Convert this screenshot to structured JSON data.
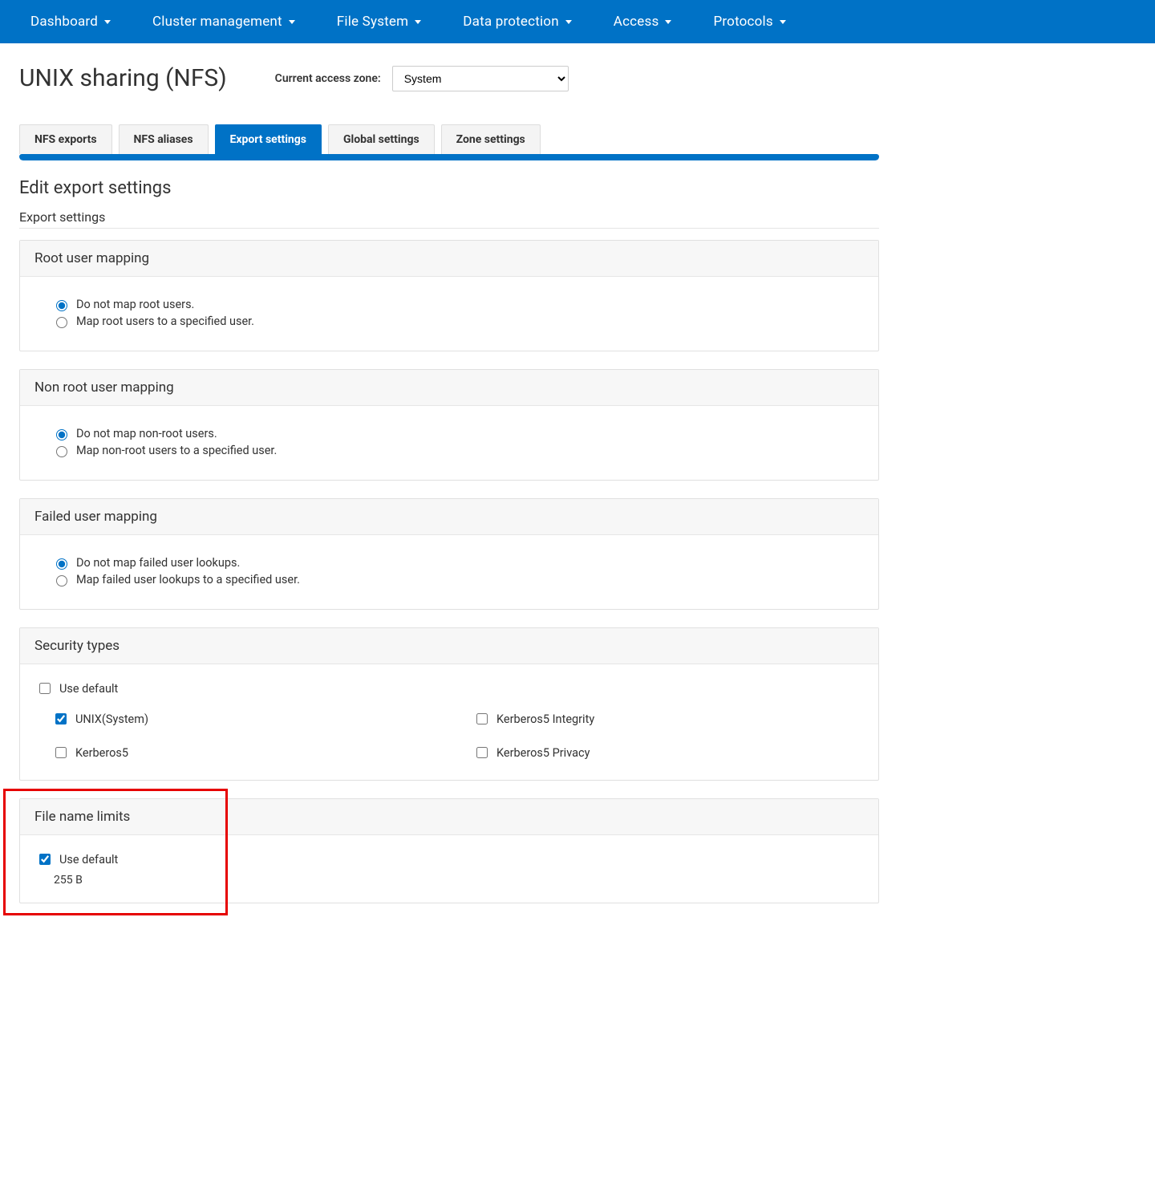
{
  "nav": {
    "items": [
      {
        "label": "Dashboard"
      },
      {
        "label": "Cluster management"
      },
      {
        "label": "File System"
      },
      {
        "label": "Data protection"
      },
      {
        "label": "Access"
      },
      {
        "label": "Protocols"
      }
    ]
  },
  "page": {
    "title": "UNIX sharing (NFS)",
    "zone_label": "Current access zone:",
    "zone_value": "System"
  },
  "tabs": [
    {
      "label": "NFS exports",
      "active": false
    },
    {
      "label": "NFS aliases",
      "active": false
    },
    {
      "label": "Export settings",
      "active": true
    },
    {
      "label": "Global settings",
      "active": false
    },
    {
      "label": "Zone settings",
      "active": false
    }
  ],
  "headings": {
    "edit": "Edit export settings",
    "sub": "Export settings"
  },
  "panels": {
    "root": {
      "title": "Root user mapping",
      "opt1": "Do not map root users.",
      "opt2": "Map root users to a specified user."
    },
    "nonroot": {
      "title": "Non root user mapping",
      "opt1": "Do not map non-root users.",
      "opt2": "Map non-root users to a specified user."
    },
    "failed": {
      "title": "Failed user mapping",
      "opt1": "Do not map failed user lookups.",
      "opt2": "Map failed user lookups to a specified user."
    },
    "security": {
      "title": "Security types",
      "use_default": "Use default",
      "unix": "UNIX(System)",
      "krb5": "Kerberos5",
      "krb5i": "Kerberos5 Integrity",
      "krb5p": "Kerberos5 Privacy"
    },
    "filename": {
      "title": "File name limits",
      "use_default": "Use default",
      "value": "255 B"
    }
  }
}
